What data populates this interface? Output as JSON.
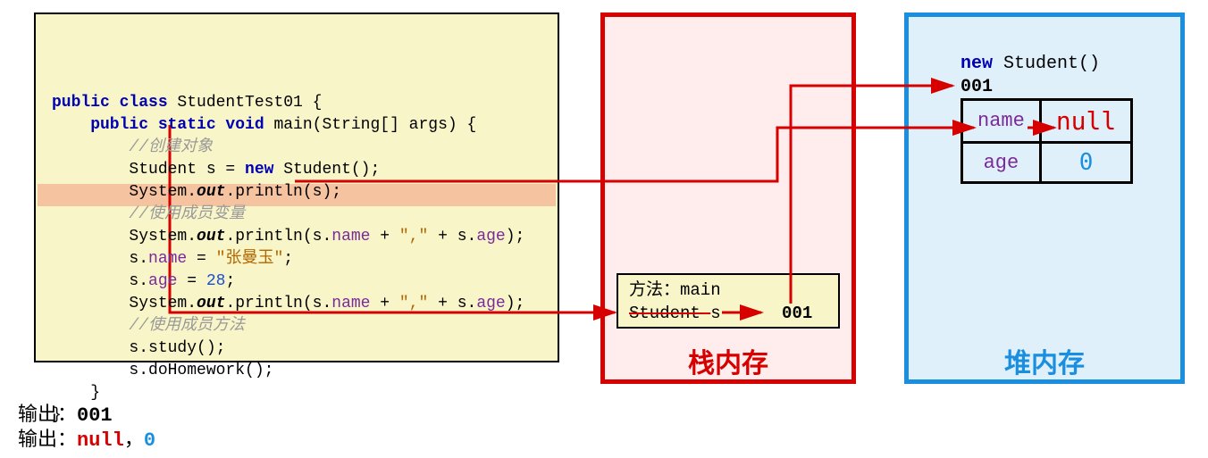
{
  "code": {
    "l1a": "public class",
    "l1b": " StudentTest01 {",
    "l2a": "    public static void",
    "l2b": " main(String[] args) {",
    "l3": "        //创建对象",
    "l4a": "        Student s = ",
    "l4b": "new",
    "l4c": " Student();",
    "l5a": "        System.",
    "l5b": "out",
    "l5c": ".println(s);",
    "l6": "        //使用成员变量",
    "l7a": "        System.",
    "l7b": "out",
    "l7c": ".println(s.",
    "l7d": "name",
    "l7e": " + ",
    "l7f": "\",\"",
    "l7g": " + s.",
    "l7h": "age",
    "l7i": ");",
    "l8a": "        s.",
    "l8b": "name",
    "l8c": " = ",
    "l8d": "\"张曼玉\"",
    "l8e": ";",
    "l9a": "        s.",
    "l9b": "age",
    "l9c": " = ",
    "l9d": "28",
    "l9e": ";",
    "l10a": "        System.",
    "l10b": "out",
    "l10c": ".println(s.",
    "l10d": "name",
    "l10e": " + ",
    "l10f": "\",\"",
    "l10g": " + s.",
    "l10h": "age",
    "l10i": ");",
    "l11": "        //使用成员方法",
    "l12": "        s.study();",
    "l13": "        s.doHomework();",
    "l14": "    }",
    "l15": "}"
  },
  "stack": {
    "label": "栈内存",
    "frame_line1": "方法：main",
    "frame_var_prefix": "Student ",
    "frame_var_name": "s",
    "frame_arrow": " → ",
    "frame_addr": "001"
  },
  "heap": {
    "label": "堆内存",
    "new_kw": "new",
    "new_call": " Student()",
    "addr": "001",
    "fields": {
      "name_label": "name",
      "name_value": "null",
      "age_label": "age",
      "age_value": "0"
    }
  },
  "output": {
    "p1": "输出：",
    "v1": "001",
    "p2": "输出：",
    "v2a": "null",
    "comma": "，",
    "v2b": "0"
  }
}
